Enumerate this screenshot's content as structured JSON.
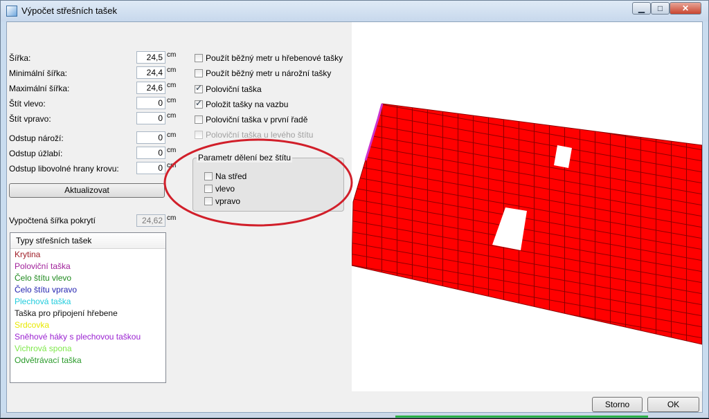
{
  "window": {
    "title": "Výpočet střešních tašek",
    "min": "▁",
    "max": "□",
    "close": "✕"
  },
  "fields": [
    {
      "label": "Šířka:",
      "value": "24,5",
      "unit": "cm"
    },
    {
      "label": "Minimální šířka:",
      "value": "24,4",
      "unit": "cm"
    },
    {
      "label": "Maximální šířka:",
      "value": "24,6",
      "unit": "cm"
    },
    {
      "label": "Štít vlevo:",
      "value": "0",
      "unit": "cm"
    },
    {
      "label": "Štít vpravo:",
      "value": "0",
      "unit": "cm"
    },
    {
      "label": "Odstup nároží:",
      "value": "0",
      "unit": "cm"
    },
    {
      "label": "Odstup úžlabí:",
      "value": "0",
      "unit": "cm"
    },
    {
      "label": "Odstup libovolné hrany krovu:",
      "value": "0",
      "unit": "cm"
    }
  ],
  "update_button": "Aktualizovat",
  "computed": {
    "label": "Vypočtená šířka pokrytí",
    "value": "24,62",
    "unit": "cm"
  },
  "checkboxes": [
    {
      "label": "Použít běžný metr u hřebenové tašky",
      "checked": false,
      "disabled": false
    },
    {
      "label": "Použít běžný metr u nárožní tašky",
      "checked": false,
      "disabled": false
    },
    {
      "label": "Poloviční taška",
      "checked": true,
      "disabled": false
    },
    {
      "label": "Položit tašky na vazbu",
      "checked": true,
      "disabled": false
    },
    {
      "label": "Poloviční taška v první řadě",
      "checked": false,
      "disabled": false
    },
    {
      "label": "Poloviční taška u levého štítu",
      "checked": false,
      "disabled": true
    }
  ],
  "group": {
    "title": "Parametr dělení bez štítu",
    "options": [
      {
        "label": "Na střed",
        "checked": false
      },
      {
        "label": "vlevo",
        "checked": false
      },
      {
        "label": "vpravo",
        "checked": false
      }
    ]
  },
  "tile_types": {
    "header": "Typy střešních tašek",
    "items": [
      {
        "label": "Krytina",
        "color": "#a0202a"
      },
      {
        "label": "Poloviční taška",
        "color": "#a0209a"
      },
      {
        "label": "Čelo štítu vlevo",
        "color": "#1f8a1f"
      },
      {
        "label": "Čelo štítu vpravo",
        "color": "#2424b0"
      },
      {
        "label": "Plechová taška",
        "color": "#22ccdd"
      },
      {
        "label": "Taška pro připojení hřebene",
        "color": "#111111"
      },
      {
        "label": "Srdcovka",
        "color": "#e8e800"
      },
      {
        "label": "Sněhové háky s plechovou taškou",
        "color": "#9b23d1"
      },
      {
        "label": "Vichrová spona",
        "color": "#7ee84a"
      },
      {
        "label": "Odvětrávací taška",
        "color": "#2a9a2a"
      }
    ]
  },
  "buttons": {
    "cancel": "Storno",
    "ok": "OK"
  },
  "colors": {
    "roof": "#ff0000",
    "roof_line": "#8c0000",
    "edge": "#cc33cc",
    "highlight": "#d11f2a"
  }
}
